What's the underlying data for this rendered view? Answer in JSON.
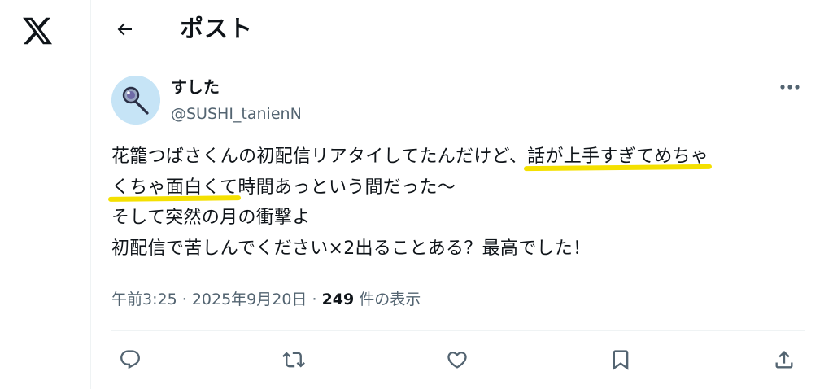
{
  "header": {
    "title": "ポスト",
    "back_icon": "arrow-left-icon"
  },
  "brand": {
    "logo": "x-logo-icon"
  },
  "post": {
    "author": {
      "display_name": "すした",
      "handle": "@SUSHI_tanienN",
      "avatar_icon": "magnifier-lollipop-avatar"
    },
    "text_lines": [
      {
        "before": "花籠つばさくんの初配信リアタイしてたんだけど、",
        "highlight": "話が上手すぎてめちゃ"
      },
      {
        "highlight": "くちゃ面白くて",
        "after": "時間あっという間だった～"
      },
      {
        "text": "そして突然の月の衝撃よ"
      },
      {
        "text": "初配信で苦しんでください×2出ることある？最高でした！"
      }
    ],
    "highlight_color": "#f4e000",
    "time": "午前3:25",
    "separator": "·",
    "date": "2025年9月20日",
    "views_count": "249",
    "views_label": "件の表示"
  },
  "actions": [
    {
      "name": "reply",
      "icon": "reply-icon"
    },
    {
      "name": "repost",
      "icon": "repost-icon"
    },
    {
      "name": "like",
      "icon": "heart-icon"
    },
    {
      "name": "bookmark",
      "icon": "bookmark-icon"
    },
    {
      "name": "share",
      "icon": "share-icon"
    }
  ],
  "colors": {
    "text": "#0f1419",
    "secondary_text": "#536471",
    "divider": "#eff3f4",
    "avatar_bg": "#c6e4f6"
  }
}
